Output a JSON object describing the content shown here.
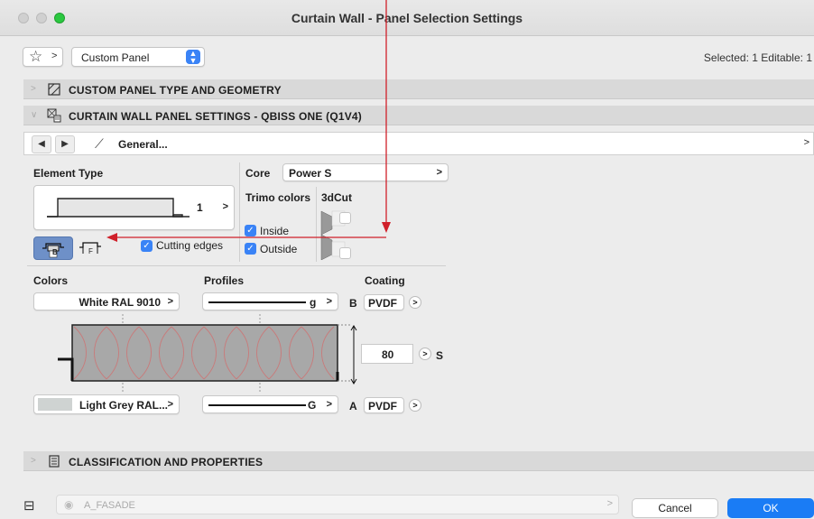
{
  "window": {
    "title": "Curtain Wall - Panel Selection Settings"
  },
  "toolbar": {
    "preset_label": "Custom Panel",
    "selection_info": "Selected: 1 Editable: 1"
  },
  "sections": {
    "geometry": "CUSTOM PANEL TYPE AND GEOMETRY",
    "settings": "CURTAIN WALL PANEL SETTINGS - QBISS ONE (Q1V4)",
    "classification": "CLASSIFICATION AND PROPERTIES"
  },
  "nav": {
    "page_label": "General..."
  },
  "element_type": {
    "label": "Element Type",
    "selector_value": "1",
    "cutting_edges_label": "Cutting edges",
    "cutting_edges_checked": true,
    "icon_b": "B",
    "icon_f": "F"
  },
  "core": {
    "label": "Core",
    "value": "Power S"
  },
  "trimo": {
    "label": "Trimo colors",
    "inside_label": "Inside",
    "inside_checked": true,
    "outside_label": "Outside",
    "outside_checked": true
  },
  "cut3d": {
    "label": "3dCut"
  },
  "columns": {
    "colors": "Colors",
    "profiles": "Profiles",
    "coating": "Coating"
  },
  "top_row": {
    "color": "White RAL 9010",
    "profile": "g",
    "side": "B",
    "coating": "PVDF"
  },
  "bottom_row": {
    "color": "Light Grey RAL...",
    "profile": "G",
    "side": "A",
    "coating": "PVDF",
    "swatch": "#cfd3d2"
  },
  "thickness": {
    "value": "80",
    "unit": "S"
  },
  "footer": {
    "layer": "A_FASADE",
    "cancel": "Cancel",
    "ok": "OK"
  },
  "colors": {
    "accent": "#3a83f6",
    "ok_button": "#1a7cf5",
    "annotation": "#d0202a"
  }
}
